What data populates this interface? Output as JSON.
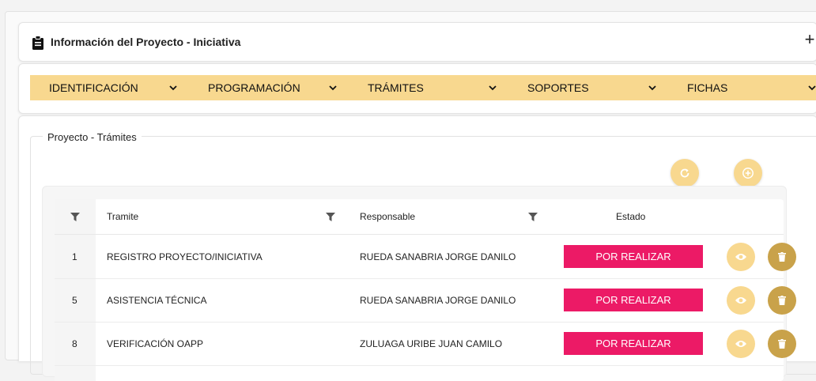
{
  "project_info": {
    "title": "Información del Proyecto - Iniciativa",
    "icon": "clipboard-icon",
    "expand_label": "+"
  },
  "tabs": [
    {
      "label": "IDENTIFICACIÓN"
    },
    {
      "label": "PROGRAMACIÓN"
    },
    {
      "label": "TRÁMITES"
    },
    {
      "label": "SOPORTES"
    },
    {
      "label": "FICHAS"
    }
  ],
  "section": {
    "legend": "Proyecto - Trámites",
    "refresh_icon": "refresh-icon",
    "add_icon": "add-circle-icon"
  },
  "table": {
    "headers": {
      "tramite": "Tramite",
      "responsable": "Responsable",
      "estado": "Estado"
    },
    "rows": [
      {
        "num": "1",
        "tramite": "REGISTRO PROYECTO/INICIATIVA",
        "responsable": "RUEDA SANABRIA JORGE DANILO",
        "estado": "POR REALIZAR"
      },
      {
        "num": "5",
        "tramite": "ASISTENCIA TÉCNICA",
        "responsable": "RUEDA SANABRIA JORGE DANILO",
        "estado": "POR REALIZAR"
      },
      {
        "num": "8",
        "tramite": "VERIFICACIÓN OAPP",
        "responsable": "ZULUAGA URIBE JUAN CAMILO",
        "estado": "POR REALIZAR"
      }
    ]
  },
  "colors": {
    "accent": "#f8d88f",
    "status_pending": "#ec1a66",
    "delete": "#c9a24a"
  }
}
